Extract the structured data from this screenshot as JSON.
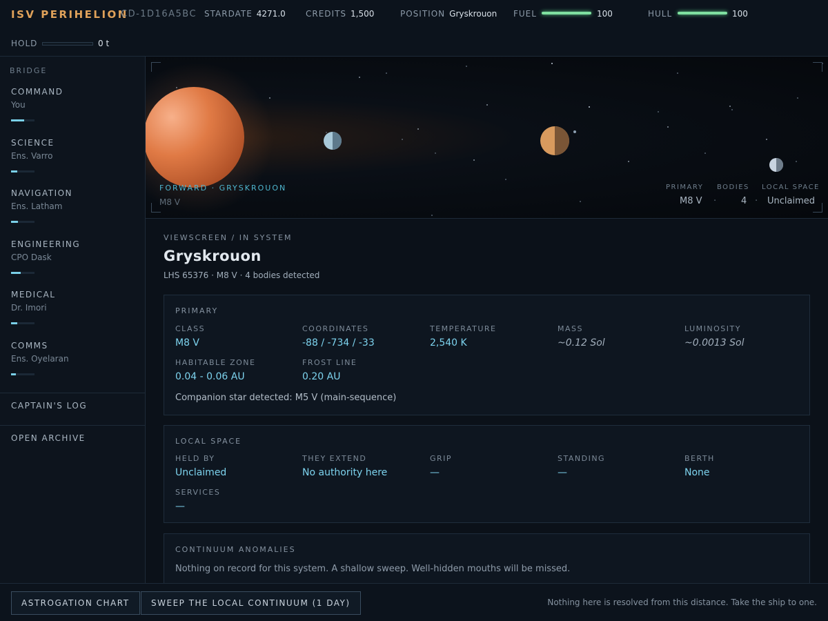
{
  "header": {
    "ship_name": "ISV PERIHELION",
    "ship_code": "CD-1D16A5BC",
    "stardate_label": "STARDATE",
    "stardate": "4271.0",
    "credits_label": "CREDITS",
    "credits": "1,500",
    "position_label": "POSITION",
    "position": "Gryskrouon",
    "fuel_label": "FUEL",
    "fuel": "100",
    "fuel_level": 1.0,
    "hull_label": "HULL",
    "hull": "100",
    "hull_level": 1.0,
    "hold_label": "HOLD",
    "hold": "0 t",
    "hold_level": 0.0,
    "meter_color": "#7fe0a0"
  },
  "sidebar": {
    "section_label": "BRIDGE",
    "stations": [
      {
        "name": "COMMAND",
        "crew": "You",
        "level": 0.55
      },
      {
        "name": "SCIENCE",
        "crew": "Ens. Varro",
        "level": 0.25
      },
      {
        "name": "NAVIGATION",
        "crew": "Ens. Latham",
        "level": 0.3
      },
      {
        "name": "ENGINEERING",
        "crew": "CPO Dask",
        "level": 0.4
      },
      {
        "name": "MEDICAL",
        "crew": "Dr. Imori",
        "level": 0.25
      },
      {
        "name": "COMMS",
        "crew": "Ens. Oyelaran",
        "level": 0.2
      }
    ],
    "captains_log": "CAPTAIN'S LOG",
    "open_archive": "OPEN ARCHIVE"
  },
  "viewscreen": {
    "forward_label": "FORWARD · GRYSKROUON",
    "star_class": "M8 V",
    "stats": {
      "primary_label": "PRIMARY",
      "primary": "M8 V",
      "bodies_label": "BODIES",
      "bodies": "4",
      "local_space_label": "LOCAL SPACE",
      "local_space": "Unclaimed"
    },
    "star_color": "#e07a45",
    "accent_color": "#4fb6cf"
  },
  "main": {
    "breadcrumb": "VIEWSCREEN / IN SYSTEM",
    "title": "Gryskrouon",
    "subtitle": "LHS 65376 · M8 V · 4 bodies detected",
    "primary_panel": {
      "title": "PRIMARY",
      "class_label": "CLASS",
      "class": "M8 V",
      "coordinates_label": "COORDINATES",
      "coordinates": "-88 / -734 / -33",
      "temperature_label": "TEMPERATURE",
      "temperature": "2,540 K",
      "mass_label": "MASS",
      "mass": "~0.12 Sol",
      "luminosity_label": "LUMINOSITY",
      "luminosity": "~0.0013 Sol",
      "habitable_zone_label": "HABITABLE ZONE",
      "habitable_zone": "0.04 - 0.06 AU",
      "frost_line_label": "FROST LINE",
      "frost_line": "0.20 AU",
      "note": "Companion star detected: M5 V (main-sequence)"
    },
    "local_space_panel": {
      "title": "LOCAL SPACE",
      "held_by_label": "HELD BY",
      "held_by": "Unclaimed",
      "they_extend_label": "THEY EXTEND",
      "they_extend": "No authority here",
      "grip_label": "GRIP",
      "grip": "—",
      "standing_label": "STANDING",
      "standing": "—",
      "berth_label": "BERTH",
      "berth": "None",
      "services_label": "SERVICES",
      "services": "—"
    },
    "anomalies_panel": {
      "title": "CONTINUUM ANOMALIES",
      "note": "Nothing on record for this system. A shallow sweep. Well-hidden mouths will be missed."
    },
    "value_color": "#7dd3ee"
  },
  "footer": {
    "astrogation_button": "ASTROGATION CHART",
    "sweep_button": "SWEEP THE LOCAL CONTINUUM (1 DAY)",
    "note": "Nothing here is resolved from this distance. Take the ship to one."
  }
}
